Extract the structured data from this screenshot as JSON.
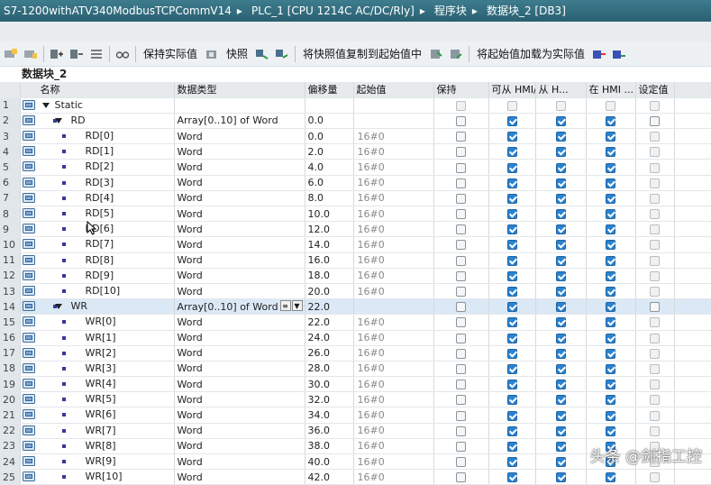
{
  "titlebar": {
    "project": "S7-1200withATV340ModbusTCPCommV14",
    "plc": "PLC_1 [CPU 1214C AC/DC/Rly]",
    "folder": "程序块",
    "block": "数据块_2 [DB3]",
    "separator": "▸"
  },
  "toolbar": {
    "keep_actual": "保持实际值",
    "snapshot": "快照",
    "copy_snapshot": "将快照值复制到起始值中",
    "load_start": "将起始值加载为实际值"
  },
  "db_title": "数据块_2",
  "columns": {
    "name": "名称",
    "datatype": "数据类型",
    "offset": "偏移量",
    "start": "起始值",
    "retain": "保持",
    "hmi_access": "可从 HMI/...",
    "hmi_visible": "从 H...",
    "hmi_setpoint": "在 HMI ...",
    "setpoint": "设定值"
  },
  "rows": [
    {
      "num": "1",
      "level": 0,
      "tri": true,
      "bullet": false,
      "name": "Static",
      "dt": "",
      "off": "",
      "sv": "",
      "retain": "dim",
      "acc": "dim",
      "vis": "dim",
      "set": "dim",
      "sp": "dim"
    },
    {
      "num": "2",
      "level": 1,
      "tri": true,
      "bullet": true,
      "name": "RD",
      "dt": "Array[0..10] of Word",
      "off": "0.0",
      "sv": "",
      "retain": "off",
      "acc": "on",
      "vis": "on",
      "set": "on",
      "sp": "off"
    },
    {
      "num": "3",
      "level": 2,
      "tri": false,
      "bullet": true,
      "name": "RD[0]",
      "dt": "Word",
      "off": "0.0",
      "sv": "16#0",
      "retain": "off",
      "acc": "on",
      "vis": "on",
      "set": "on",
      "sp": "dim"
    },
    {
      "num": "4",
      "level": 2,
      "tri": false,
      "bullet": true,
      "name": "RD[1]",
      "dt": "Word",
      "off": "2.0",
      "sv": "16#0",
      "retain": "off",
      "acc": "on",
      "vis": "on",
      "set": "on",
      "sp": "dim"
    },
    {
      "num": "5",
      "level": 2,
      "tri": false,
      "bullet": true,
      "name": "RD[2]",
      "dt": "Word",
      "off": "4.0",
      "sv": "16#0",
      "retain": "off",
      "acc": "on",
      "vis": "on",
      "set": "on",
      "sp": "dim"
    },
    {
      "num": "6",
      "level": 2,
      "tri": false,
      "bullet": true,
      "name": "RD[3]",
      "dt": "Word",
      "off": "6.0",
      "sv": "16#0",
      "retain": "off",
      "acc": "on",
      "vis": "on",
      "set": "on",
      "sp": "dim"
    },
    {
      "num": "7",
      "level": 2,
      "tri": false,
      "bullet": true,
      "name": "RD[4]",
      "dt": "Word",
      "off": "8.0",
      "sv": "16#0",
      "retain": "off",
      "acc": "on",
      "vis": "on",
      "set": "on",
      "sp": "dim"
    },
    {
      "num": "8",
      "level": 2,
      "tri": false,
      "bullet": true,
      "name": "RD[5]",
      "dt": "Word",
      "off": "10.0",
      "sv": "16#0",
      "retain": "off",
      "acc": "on",
      "vis": "on",
      "set": "on",
      "sp": "dim"
    },
    {
      "num": "9",
      "level": 2,
      "tri": false,
      "bullet": true,
      "name": "RD[6]",
      "dt": "Word",
      "off": "12.0",
      "sv": "16#0",
      "retain": "off",
      "acc": "on",
      "vis": "on",
      "set": "on",
      "sp": "dim"
    },
    {
      "num": "10",
      "level": 2,
      "tri": false,
      "bullet": true,
      "name": "RD[7]",
      "dt": "Word",
      "off": "14.0",
      "sv": "16#0",
      "retain": "off",
      "acc": "on",
      "vis": "on",
      "set": "on",
      "sp": "dim"
    },
    {
      "num": "11",
      "level": 2,
      "tri": false,
      "bullet": true,
      "name": "RD[8]",
      "dt": "Word",
      "off": "16.0",
      "sv": "16#0",
      "retain": "off",
      "acc": "on",
      "vis": "on",
      "set": "on",
      "sp": "dim"
    },
    {
      "num": "12",
      "level": 2,
      "tri": false,
      "bullet": true,
      "name": "RD[9]",
      "dt": "Word",
      "off": "18.0",
      "sv": "16#0",
      "retain": "off",
      "acc": "on",
      "vis": "on",
      "set": "on",
      "sp": "dim"
    },
    {
      "num": "13",
      "level": 2,
      "tri": false,
      "bullet": true,
      "name": "RD[10]",
      "dt": "Word",
      "off": "20.0",
      "sv": "16#0",
      "retain": "off",
      "acc": "on",
      "vis": "on",
      "set": "on",
      "sp": "dim"
    },
    {
      "num": "14",
      "level": 1,
      "tri": true,
      "bullet": true,
      "name": "WR",
      "dt": "Array[0..10] of Word",
      "off": "22.0",
      "sv": "",
      "retain": "off",
      "acc": "on",
      "vis": "on",
      "set": "on",
      "sp": "off",
      "selected": true
    },
    {
      "num": "15",
      "level": 2,
      "tri": false,
      "bullet": true,
      "name": "WR[0]",
      "dt": "Word",
      "off": "22.0",
      "sv": "16#0",
      "retain": "off",
      "acc": "on",
      "vis": "on",
      "set": "on",
      "sp": "dim"
    },
    {
      "num": "16",
      "level": 2,
      "tri": false,
      "bullet": true,
      "name": "WR[1]",
      "dt": "Word",
      "off": "24.0",
      "sv": "16#0",
      "retain": "off",
      "acc": "on",
      "vis": "on",
      "set": "on",
      "sp": "dim"
    },
    {
      "num": "17",
      "level": 2,
      "tri": false,
      "bullet": true,
      "name": "WR[2]",
      "dt": "Word",
      "off": "26.0",
      "sv": "16#0",
      "retain": "off",
      "acc": "on",
      "vis": "on",
      "set": "on",
      "sp": "dim"
    },
    {
      "num": "18",
      "level": 2,
      "tri": false,
      "bullet": true,
      "name": "WR[3]",
      "dt": "Word",
      "off": "28.0",
      "sv": "16#0",
      "retain": "off",
      "acc": "on",
      "vis": "on",
      "set": "on",
      "sp": "dim"
    },
    {
      "num": "19",
      "level": 2,
      "tri": false,
      "bullet": true,
      "name": "WR[4]",
      "dt": "Word",
      "off": "30.0",
      "sv": "16#0",
      "retain": "off",
      "acc": "on",
      "vis": "on",
      "set": "on",
      "sp": "dim"
    },
    {
      "num": "20",
      "level": 2,
      "tri": false,
      "bullet": true,
      "name": "WR[5]",
      "dt": "Word",
      "off": "32.0",
      "sv": "16#0",
      "retain": "off",
      "acc": "on",
      "vis": "on",
      "set": "on",
      "sp": "dim"
    },
    {
      "num": "21",
      "level": 2,
      "tri": false,
      "bullet": true,
      "name": "WR[6]",
      "dt": "Word",
      "off": "34.0",
      "sv": "16#0",
      "retain": "off",
      "acc": "on",
      "vis": "on",
      "set": "on",
      "sp": "dim"
    },
    {
      "num": "22",
      "level": 2,
      "tri": false,
      "bullet": true,
      "name": "WR[7]",
      "dt": "Word",
      "off": "36.0",
      "sv": "16#0",
      "retain": "off",
      "acc": "on",
      "vis": "on",
      "set": "on",
      "sp": "dim"
    },
    {
      "num": "23",
      "level": 2,
      "tri": false,
      "bullet": true,
      "name": "WR[8]",
      "dt": "Word",
      "off": "38.0",
      "sv": "16#0",
      "retain": "off",
      "acc": "on",
      "vis": "on",
      "set": "on",
      "sp": "dim"
    },
    {
      "num": "24",
      "level": 2,
      "tri": false,
      "bullet": true,
      "name": "WR[9]",
      "dt": "Word",
      "off": "40.0",
      "sv": "16#0",
      "retain": "off",
      "acc": "on",
      "vis": "on",
      "set": "on",
      "sp": "dim"
    },
    {
      "num": "25",
      "level": 2,
      "tri": false,
      "bullet": true,
      "name": "WR[10]",
      "dt": "Word",
      "off": "42.0",
      "sv": "16#0",
      "retain": "off",
      "acc": "on",
      "vis": "on",
      "set": "on",
      "sp": "dim"
    }
  ],
  "watermark": "头条 @剑指工控",
  "colors": {
    "accent": "#2a83d0",
    "title_bg": "#2f6b7c",
    "selected_row": "#dbe8f5"
  }
}
